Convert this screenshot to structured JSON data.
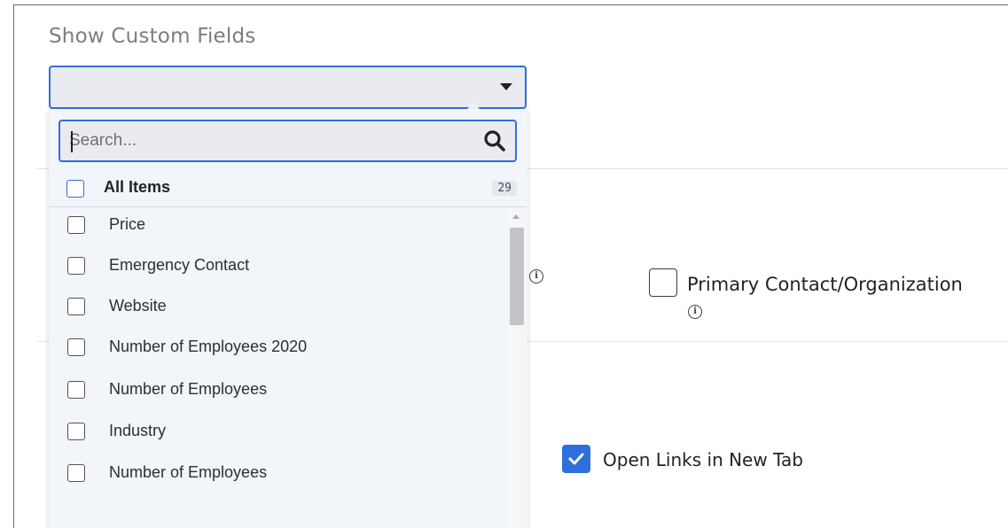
{
  "section": {
    "title": "Show Custom Fields"
  },
  "search": {
    "placeholder": "Search..."
  },
  "all_items": {
    "label": "All Items",
    "count": "29"
  },
  "items": [
    {
      "label": "Price"
    },
    {
      "label": "Emergency Contact"
    },
    {
      "label": "Website"
    },
    {
      "label": "Number of Employees 2020"
    },
    {
      "label": "Number of Employees"
    },
    {
      "label": "Industry"
    },
    {
      "label": "Number of Employees"
    }
  ],
  "options": {
    "primary_contact_label": "Primary Contact/Organization",
    "open_links_label": "Open Links in New Tab",
    "open_links_checked": true
  },
  "colors": {
    "accent": "#2f6fdc",
    "dropdown_bg": "#f2f5fa",
    "field_bg": "#e9ebf1"
  },
  "icons": {
    "caret": "caret-down-icon",
    "search": "search-icon",
    "info": "info-icon",
    "check": "check-icon"
  }
}
